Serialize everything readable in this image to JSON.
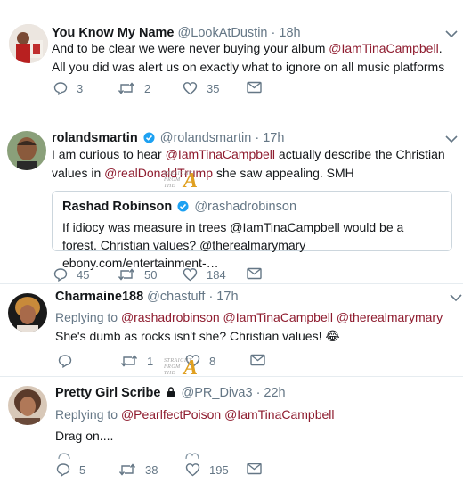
{
  "tweets": [
    {
      "name": "You Know My Name",
      "handle": "@LookAtDustin",
      "time": "· 18h",
      "text": [
        "And to be clear we were never buying your album ",
        "@IamTinaCampbell",
        ". All you did was alert us on exactly what to ignore on all music platforms"
      ],
      "replies": "3",
      "retweets": "2",
      "likes": "35"
    },
    {
      "name": "rolandsmartin",
      "handle": "@rolandsmartin",
      "time": "· 17h",
      "text": [
        "I am curious to hear ",
        "@IamTinaCampbell",
        " actually describe the Christian values in ",
        "@realDonaldTrump",
        " she saw appealing. SMH"
      ],
      "replies": "45",
      "retweets": "50",
      "likes": "184",
      "quote": {
        "name": "Rashad Robinson",
        "handle": "@rashadrobinson",
        "text": "If idiocy was measure in trees @IamTinaCampbell would be a forest. Christian values? @therealmarymary ebony.com/entertainment-…"
      }
    },
    {
      "name": "Charmaine188",
      "handle": "@chastuff",
      "time": "· 17h",
      "replying_prefix": "Replying to ",
      "replying_to": "@rashadrobinson @IamTinaCampbell @therealmarymary",
      "text": "She's dumb as rocks isn't she? Christian values! 😂",
      "retweets": "1",
      "likes": "8"
    },
    {
      "name": "Pretty Girl Scribe",
      "handle": "@PR_Diva3",
      "time": "· 22h",
      "replying_prefix": "Replying to ",
      "replying_to": "@PearlfectPoison @IamTinaCampbell",
      "text": "Drag on....",
      "replies": "5",
      "retweets": "38",
      "likes": "195"
    }
  ],
  "watermark": {
    "line1": "STRAIGHT",
    "line2": "FROM",
    "line3": "THE",
    "letter": "A"
  },
  "colors": {
    "mention": "#8e1b2e",
    "verified": "#1da1f2",
    "icon": "#657786",
    "separator": "#e6ecf0"
  }
}
